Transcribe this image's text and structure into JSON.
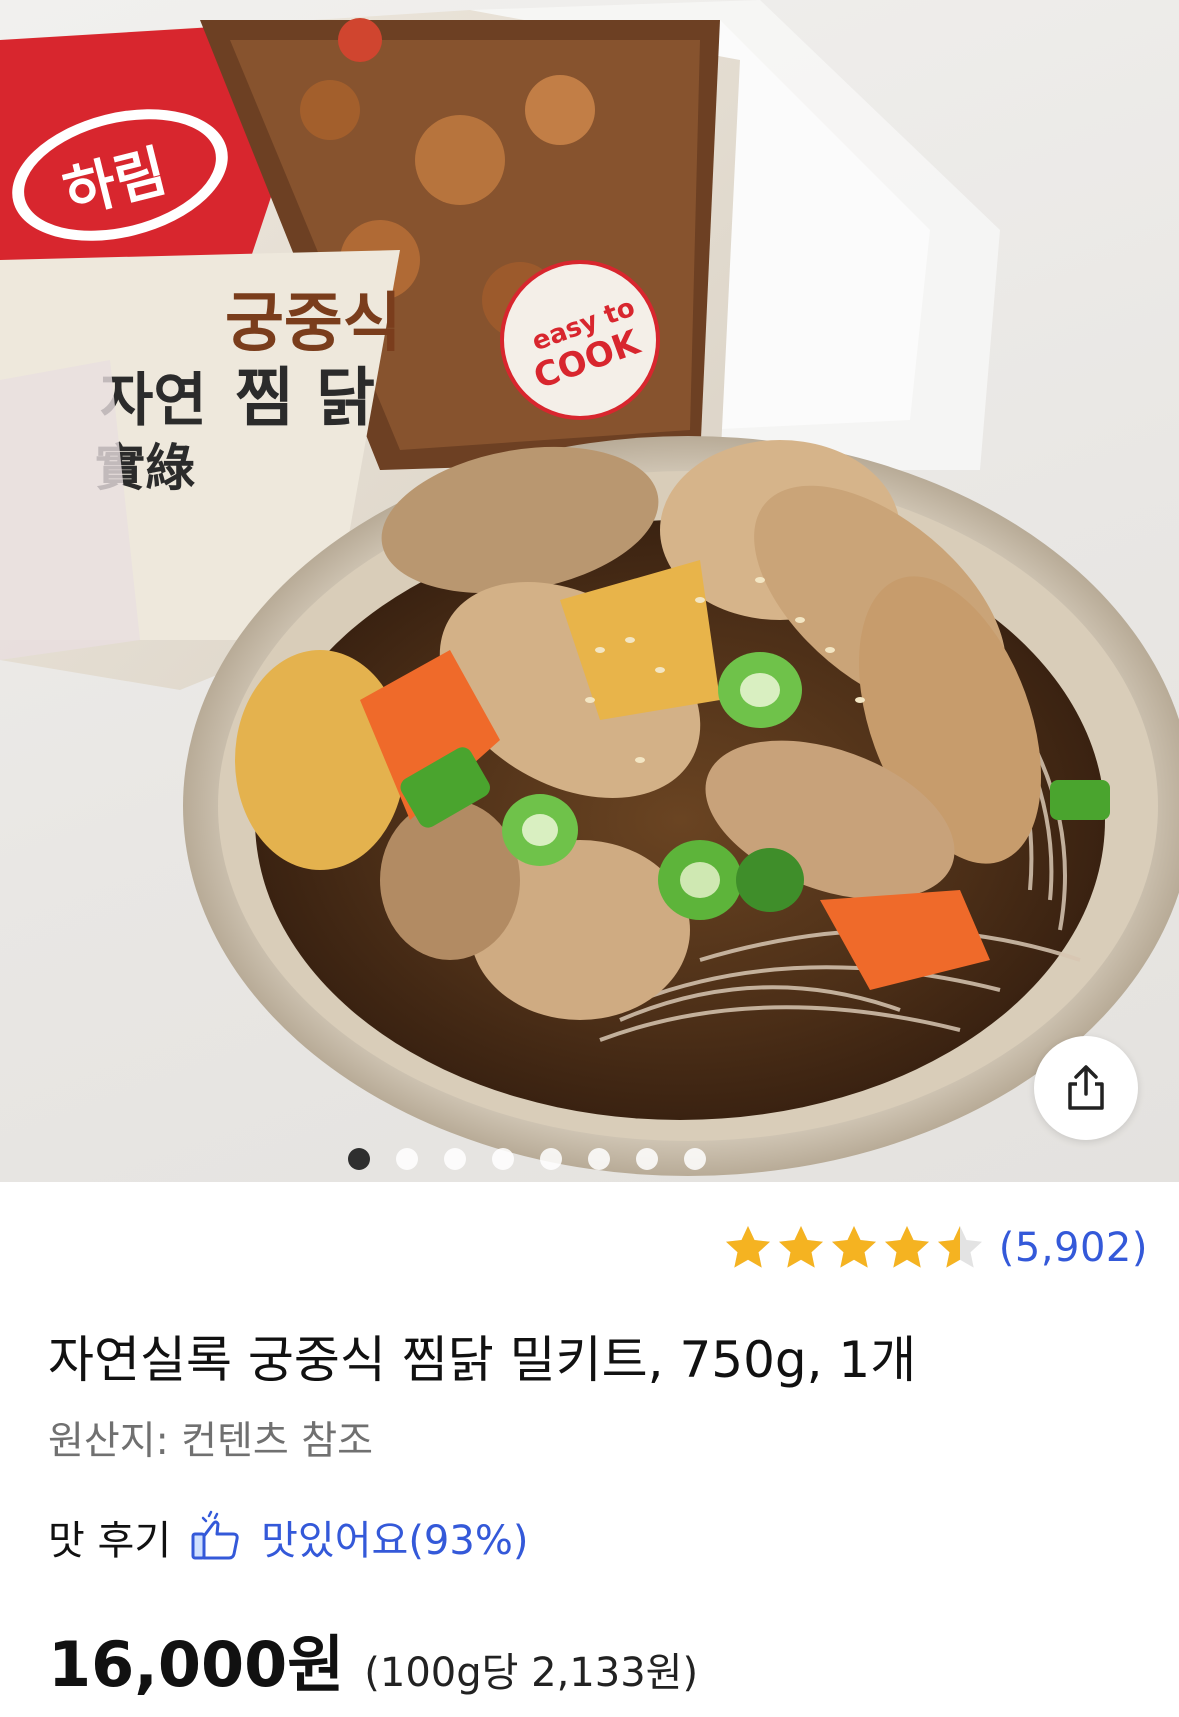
{
  "image": {
    "package_brand": "하림",
    "package_line": "자연實綠",
    "package_title_1": "궁중식",
    "package_title_2": "찜닭",
    "package_badge": "easy to COOK",
    "carousel_count": 8,
    "carousel_active_index": 0
  },
  "share": {
    "icon": "share-icon"
  },
  "rating": {
    "stars": 4.5,
    "count_label": "(5,902)",
    "star_color": "#f5b321"
  },
  "product": {
    "title": "자연실록 궁중식 찜닭 밀키트, 750g, 1개",
    "origin": "원산지: 컨텐츠 참조"
  },
  "taste": {
    "label": "맛 후기",
    "icon": "thumbs-up-icon",
    "value": "맛있어요(93%)"
  },
  "price": {
    "amount": "16,000원",
    "unit": "(100g당 2,133원)"
  },
  "colors": {
    "accent_blue": "#3459d9",
    "brand_red": "#d8262e"
  }
}
